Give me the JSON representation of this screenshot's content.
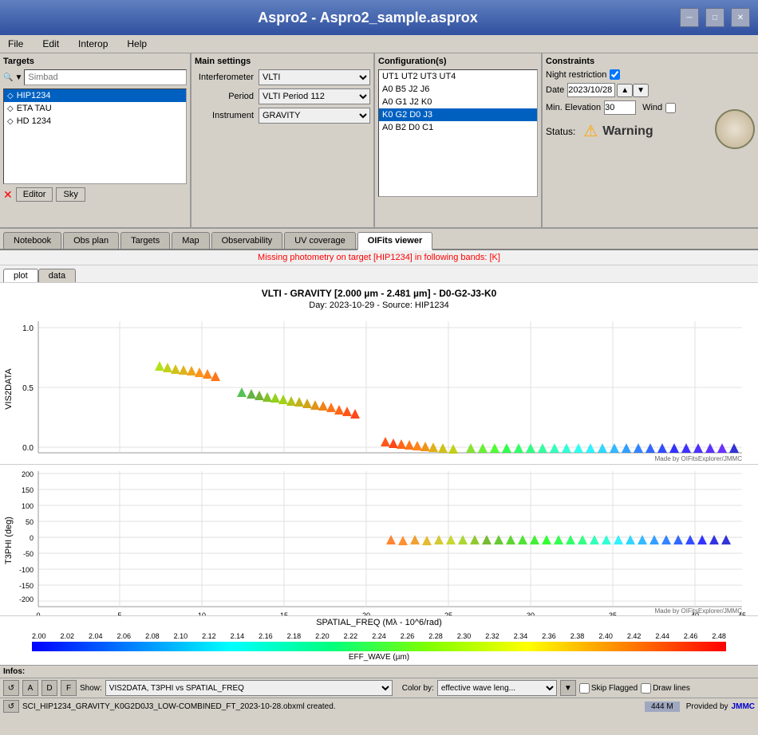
{
  "app": {
    "title": "Aspro2 - Aspro2_sample.asprox"
  },
  "menu": {
    "items": [
      "File",
      "Edit",
      "Interop",
      "Help"
    ]
  },
  "targets": {
    "panel_label": "Targets",
    "search_placeholder": "Simbad",
    "items": [
      {
        "name": "HIP1234",
        "selected": true
      },
      {
        "name": "ETA TAU",
        "selected": false
      },
      {
        "name": "HD 1234",
        "selected": false
      }
    ],
    "editor_btn": "Editor",
    "sky_btn": "Sky"
  },
  "main_settings": {
    "panel_label": "Main settings",
    "interferometer_label": "Interferometer",
    "interferometer_value": "VLTI",
    "period_label": "Period",
    "period_value": "VLTI Period 112",
    "instrument_label": "Instrument",
    "instrument_value": "GRAVITY"
  },
  "configurations": {
    "panel_label": "Configuration(s)",
    "items": [
      {
        "label": "UT1 UT2 UT3 UT4",
        "selected": false
      },
      {
        "label": "A0 B5 J2 J6",
        "selected": false
      },
      {
        "label": "A0 G1 J2 K0",
        "selected": false
      },
      {
        "label": "K0 G2 D0 J3",
        "selected": true
      },
      {
        "label": "A0 B2 D0 C1",
        "selected": false
      }
    ]
  },
  "constraints": {
    "panel_label": "Constraints",
    "night_restriction_label": "Night restriction",
    "night_restriction_checked": true,
    "date_label": "Date",
    "date_value": "2023/10/28",
    "min_elevation_label": "Min. Elevation",
    "min_elevation_value": "30",
    "wind_label": "Wind",
    "wind_checked": false,
    "status_label": "Status:",
    "status_value": "Warning"
  },
  "tabs": {
    "items": [
      "Notebook",
      "Obs plan",
      "Targets",
      "Map",
      "Observability",
      "UV coverage",
      "OIFits viewer"
    ],
    "active": "OIFits viewer"
  },
  "warning_banner": "Missing photometry on target [HIP1234] in following bands: [K]",
  "sub_tabs": {
    "items": [
      "plot",
      "data"
    ],
    "active": "plot"
  },
  "chart": {
    "title": "VLTI - GRAVITY [2.000 µm - 2.481 µm] - D0-G2-J3-K0",
    "subtitle": "Day: 2023-10-29 - Source: HIP1234",
    "y1_label": "VIS2DATA",
    "y2_label": "T3PHI (deg)",
    "x_label": "SPATIAL_FREQ (Mλ - 10^6/rad)",
    "y1_max": "1.0",
    "y1_mid": "0.5",
    "y1_zero": "0.0",
    "y2_values": [
      "200",
      "150",
      "100",
      "50",
      "0",
      "-50",
      "-100",
      "-150",
      "-200"
    ],
    "x_values": [
      "0",
      "5",
      "10",
      "15",
      "20",
      "25",
      "30",
      "35",
      "40",
      "45"
    ],
    "watermark": "Made by OIFitsExplorer/JMMC"
  },
  "colorbar": {
    "labels": [
      "2.00",
      "2.02",
      "2.04",
      "2.06",
      "2.08",
      "2.10",
      "2.12",
      "2.14",
      "2.16",
      "2.18",
      "2.20",
      "2.22",
      "2.24",
      "2.26",
      "2.28",
      "2.30",
      "2.32",
      "2.34",
      "2.36",
      "2.38",
      "2.40",
      "2.42",
      "2.44",
      "2.46",
      "2.48"
    ],
    "axis_label": "EFF_WAVE (µm)"
  },
  "infos": {
    "label": "Infos:"
  },
  "controls": {
    "show_label": "Show:",
    "show_value": "VIS2DATA, T3PHI vs SPATIAL_FREQ",
    "color_by_label": "Color by:",
    "color_by_value": "effective wave leng...",
    "skip_flagged_label": "Skip Flagged",
    "draw_lines_label": "Draw lines"
  },
  "status_bar": {
    "file_text": "SCI_HIP1234_GRAVITY_K0G2D0J3_LOW-COMBINED_FT_2023-10-28.obxml created.",
    "file_size": "444 M",
    "provided_by": "Provided by"
  }
}
